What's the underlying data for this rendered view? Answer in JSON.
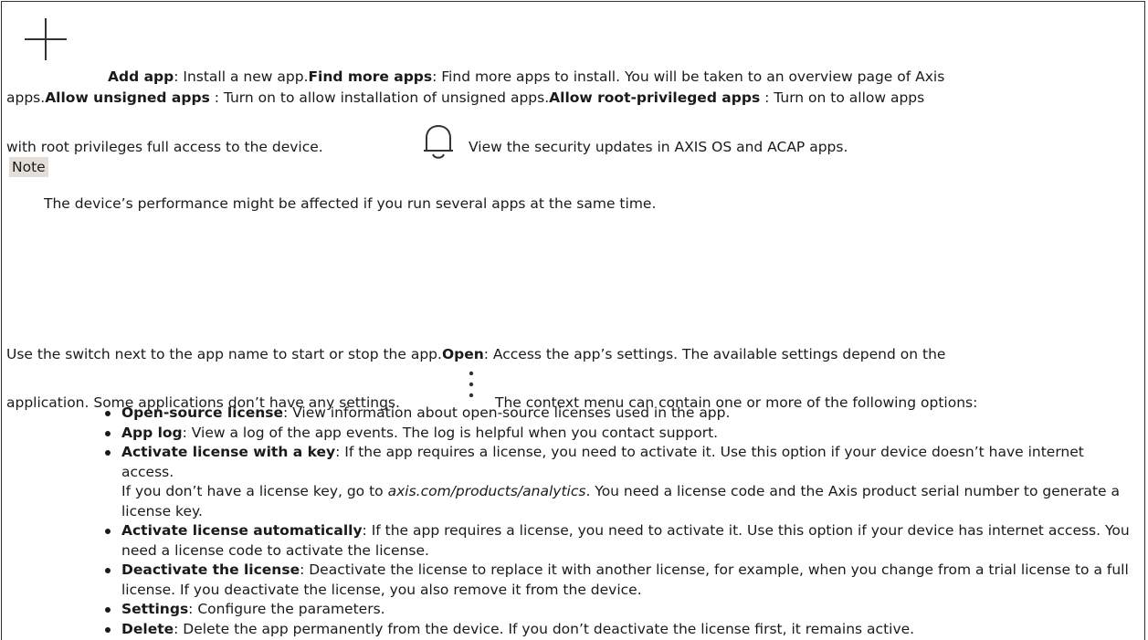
{
  "intro": {
    "add_app_title": "Add app",
    "add_app_text": ": Install a new app.",
    "find_more_title": "Find more apps",
    "find_more_text": ": Find more apps to install. You will be taken to an overview page of Axis",
    "line2_prefix": "apps.",
    "allow_unsigned_title": "Allow unsigned apps",
    "allow_unsigned_text": " : Turn on to allow installation of unsigned apps.",
    "allow_root_title": "Allow root-privileged apps",
    "allow_root_text": " : Turn on to allow apps",
    "line3_text": "with root privileges full access to the device.",
    "security_text": "View the security updates in AXIS OS and ACAP apps."
  },
  "note": {
    "label": "Note",
    "text": "The device’s performance might be affected if you run several apps at the same time."
  },
  "app_controls": {
    "switch_text": "Use the switch next to the app name to start or stop the app.",
    "open_title": "Open",
    "open_text": ": Access the app’s settings. The available settings depend on the",
    "line2_text": "application. Some applications don’t have any settings.",
    "context_menu_text": "The context menu can contain one or more of the following options:"
  },
  "options": [
    {
      "title": "Open-source license",
      "text": ": View information about open-source licenses used in the app."
    },
    {
      "title": "App log",
      "text": ": View a log of the app events. The log is helpful when you contact support."
    },
    {
      "title": "Activate license with a key",
      "text": ": If the app requires a license, you need to activate it. Use this option if your device doesn’t have internet access.",
      "extra_prefix": "If you don’t have a license key, go to ",
      "extra_link": "axis.com/products/analytics",
      "extra_suffix": ". You need a license code and the Axis product serial number to generate a license key."
    },
    {
      "title": "Activate license automatically",
      "text": ": If the app requires a license, you need to activate it. Use this option if your device has internet access. You need a license code to activate the license."
    },
    {
      "title": "Deactivate the license",
      "text": ": Deactivate the license to replace it with another license, for example, when you change from a trial license to a full license. If you deactivate the license, you also remove it from the device."
    },
    {
      "title": "Settings",
      "text": ": Configure the parameters."
    },
    {
      "title": "Delete",
      "text": ": Delete the app permanently from the device. If you don’t deactivate the license first, it remains active."
    }
  ],
  "icons": {
    "add": "plus-icon",
    "security": "bell-icon",
    "context_menu": "vertical-dots-icon"
  }
}
